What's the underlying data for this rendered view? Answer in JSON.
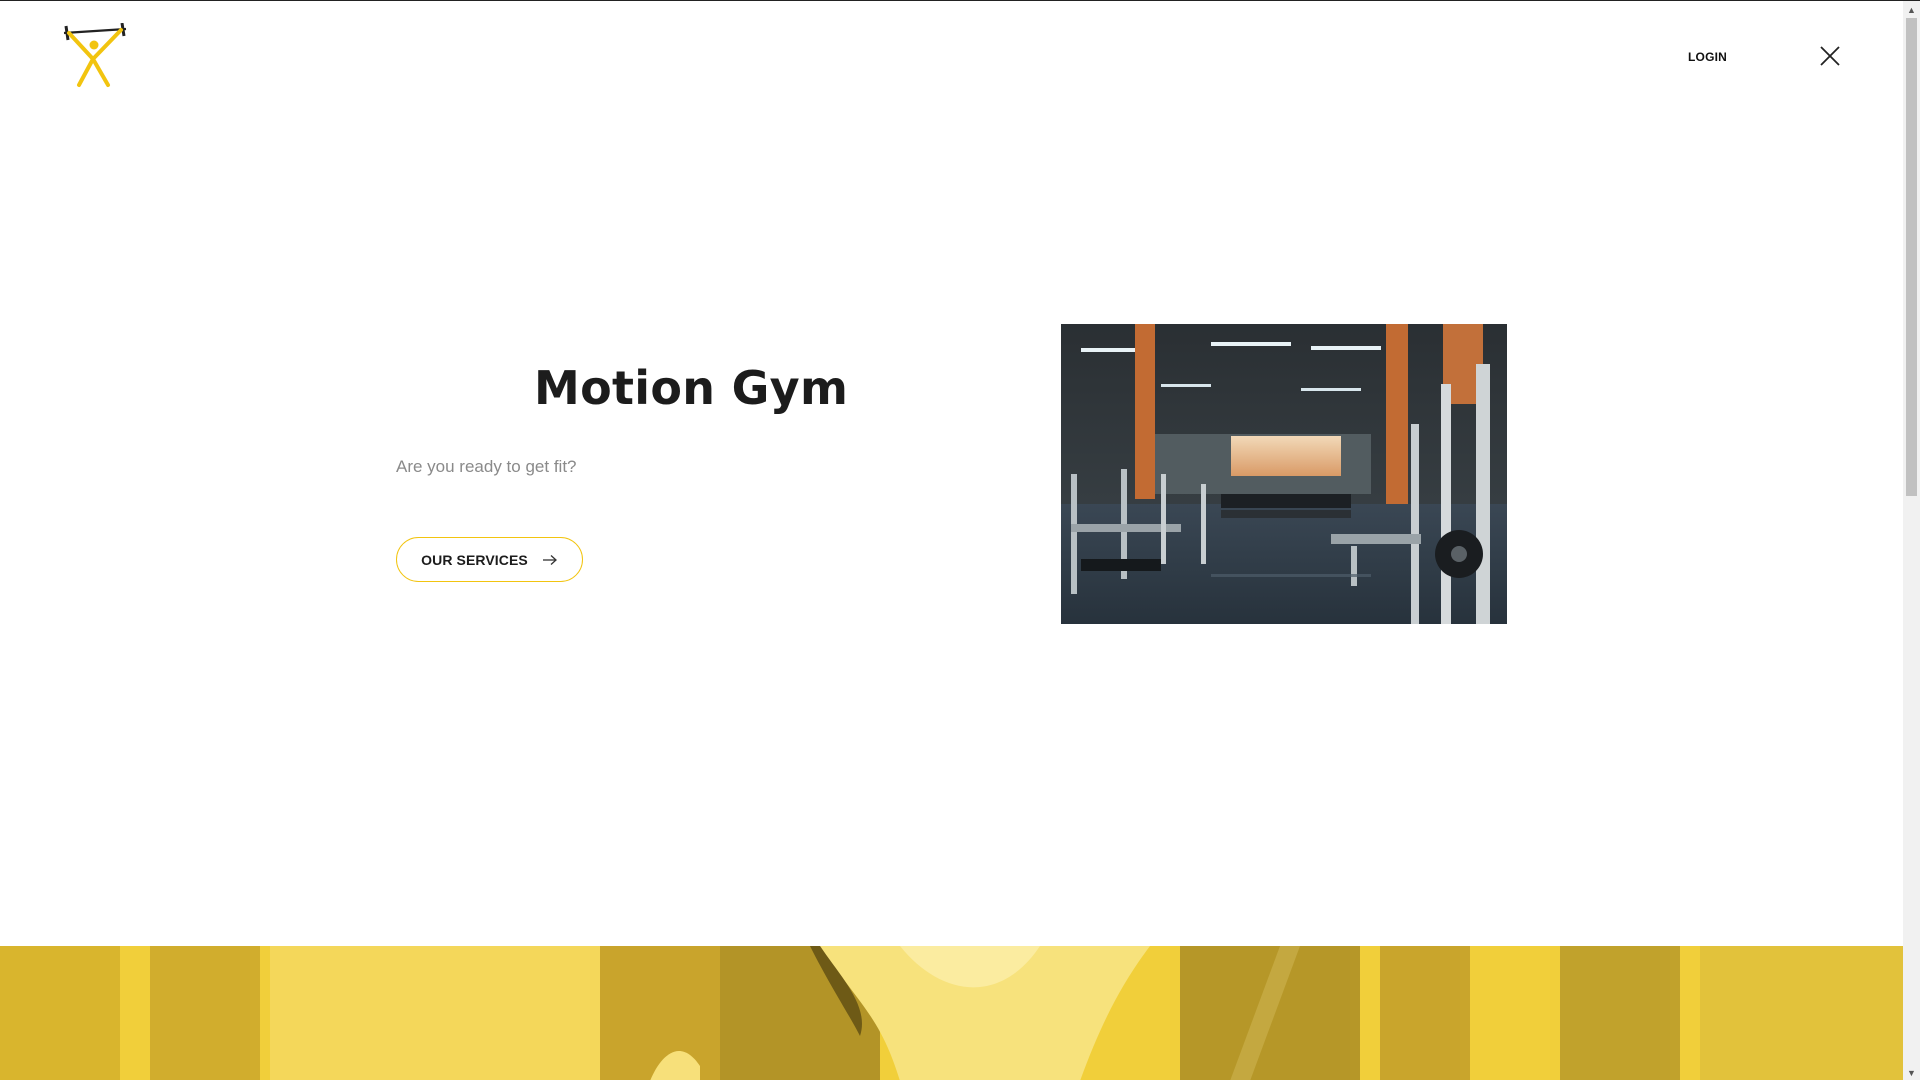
{
  "header": {
    "login_label": "LOGIN",
    "logo_icon": "weightlifter-logo-icon",
    "close_icon": "close-icon"
  },
  "hero": {
    "title": "Motion Gym",
    "subtitle": "Are you ready to get fit?",
    "cta_label": "OUR SERVICES",
    "cta_icon": "arrow-right-icon"
  },
  "media": {
    "photo": "gym-interior-photo",
    "banner": "yellow-tinted-fitness-banner"
  },
  "colors": {
    "accent": "#f2c40f",
    "text_dark": "#1c1c1c",
    "text_muted": "#8a8a8a",
    "band_yellow": "#f0cd33"
  }
}
